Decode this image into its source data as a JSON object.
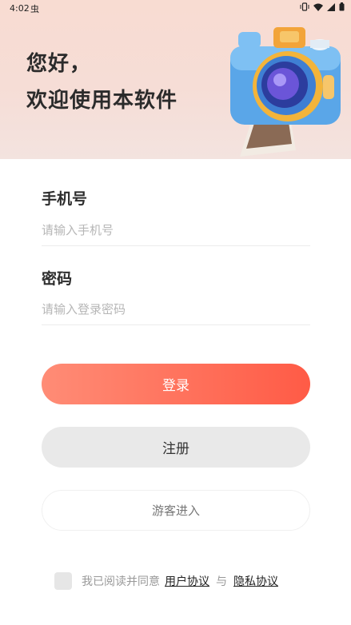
{
  "status_bar": {
    "time": "4:02",
    "debug_glyph": "虫",
    "icons": [
      "vibrate-icon",
      "wifi-icon",
      "signal-icon",
      "battery-icon"
    ]
  },
  "hero": {
    "greeting_line1": "您好，",
    "greeting_line2": "欢迎使用本软件",
    "illustration": "camera-icon"
  },
  "form": {
    "phone_label": "手机号",
    "phone_placeholder": "请输入手机号",
    "phone_value": "",
    "password_label": "密码",
    "password_placeholder": "请输入登录密码",
    "password_value": ""
  },
  "buttons": {
    "login": "登录",
    "register": "注册",
    "guest": "游客进入"
  },
  "agreement": {
    "checked": false,
    "prefix": "我已阅读并同意",
    "user_agreement": "用户协议",
    "conjunction": "与",
    "privacy_policy": "隐私协议"
  },
  "colors": {
    "login_gradient_start": "#ff8c76",
    "login_gradient_end": "#ff5b46",
    "hero_background": "#f8dcd2",
    "register_background": "#e9e9e9"
  }
}
